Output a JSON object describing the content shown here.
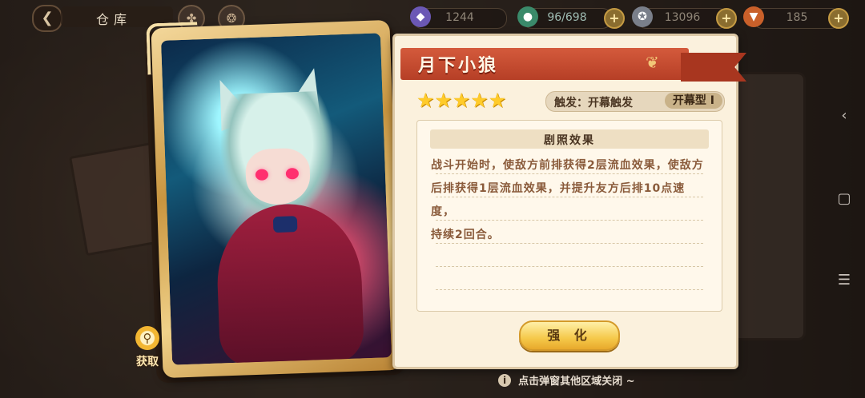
{
  "topbar": {
    "back_icon": "back-arrow-icon",
    "title": "仓库",
    "resources": [
      {
        "name": "crystal",
        "value": "1244"
      },
      {
        "name": "stamina",
        "value": "96/698"
      },
      {
        "name": "coin",
        "value": "13096"
      },
      {
        "name": "carrot",
        "value": "185"
      }
    ]
  },
  "card": {
    "name": "月下小狼",
    "stars": [
      "★",
      "★",
      "★",
      "★",
      "★"
    ],
    "trigger_label": "触发：开幕触发",
    "trigger_type": "开幕型 Ⅰ",
    "effect_title": "剧照效果",
    "effect_lines": [
      "战斗开始时，使敌方前排获得2层流血效果，使敌方",
      "后排获得1层流血效果，并提升友方后排10点速度，",
      "持续2回合。"
    ],
    "enhance_label": "强 化",
    "obtain_label": "获取"
  },
  "footer": {
    "hint": "点击弹窗其他区域关闭 ~"
  },
  "nav": {
    "back": "‹",
    "home": "▢",
    "menu": "☰"
  },
  "colors": {
    "ribbon": "#d45a3c",
    "star": "#ffcb2a",
    "panel": "#fbf1dd",
    "button": "#f5c94a"
  }
}
